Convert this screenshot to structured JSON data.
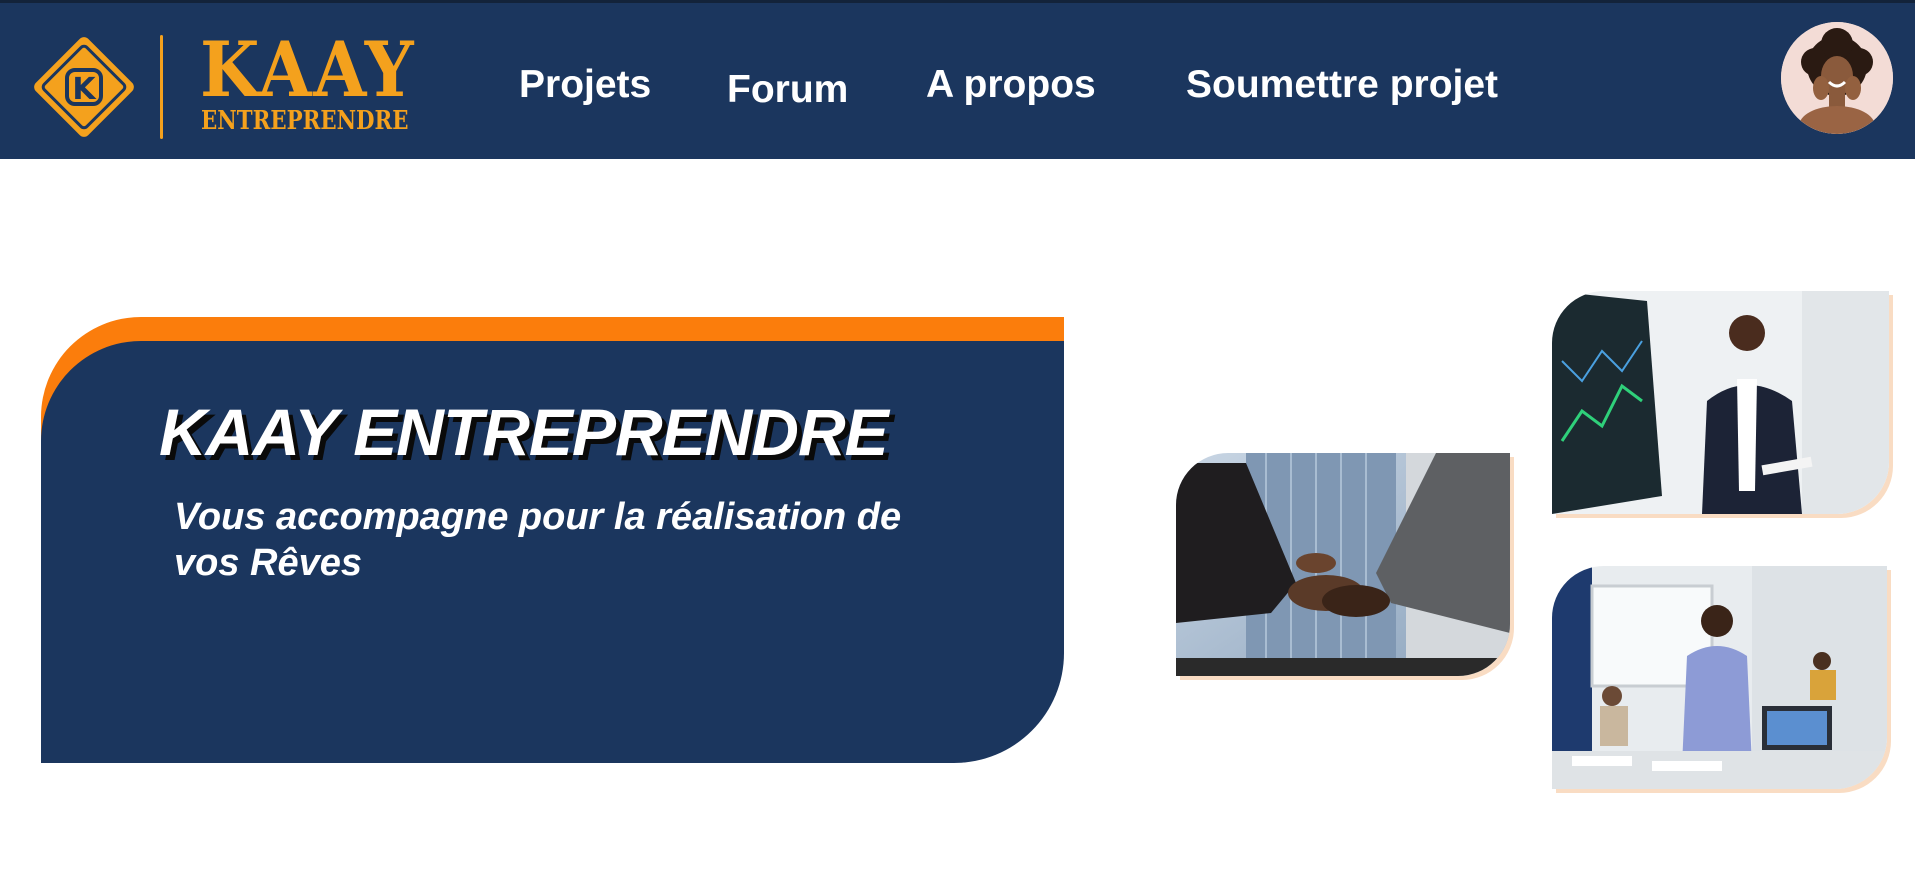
{
  "brand": {
    "logo_letter": "K",
    "name": "KAAY",
    "tagline": "ENTREPRENDRE",
    "color_orange": "#f4a11d",
    "color_navy": "#1b365e",
    "accent_orange": "#fb7d0c"
  },
  "nav": {
    "items": [
      {
        "label": "Projets"
      },
      {
        "label": "Forum"
      },
      {
        "label": "A propos"
      },
      {
        "label": "Soumettre projet"
      }
    ]
  },
  "user": {
    "avatar_icon": "user-avatar"
  },
  "hero": {
    "title": "KAAY ENTREPRENDRE",
    "subtitle": "Vous accompagne pour la réalisation de\n vos Rêves"
  },
  "photos": [
    {
      "subject": "handshake-photo"
    },
    {
      "subject": "presenter-photo"
    },
    {
      "subject": "office-woman-photo"
    }
  ]
}
